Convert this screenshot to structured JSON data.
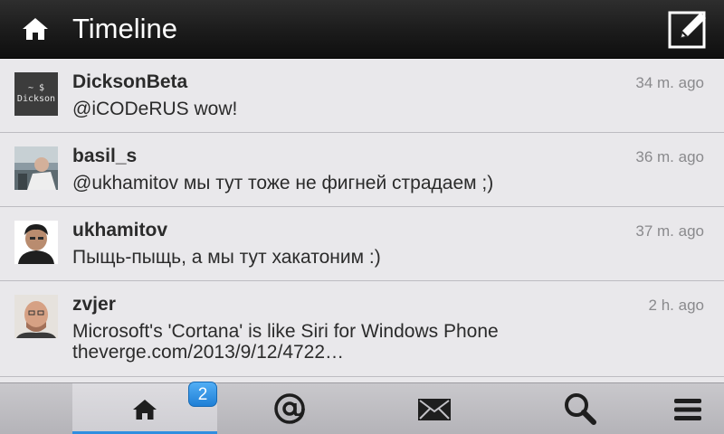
{
  "header": {
    "title": "Timeline",
    "home_icon": "home-icon",
    "compose_icon": "compose-icon"
  },
  "tweets": [
    {
      "author": "DicksonBeta",
      "time": "34 m. ago",
      "text": "@iCODeRUS wow!",
      "avatar_text_1": "~ $",
      "avatar_text_2": "Dickson"
    },
    {
      "author": "basil_s",
      "time": "36 m. ago",
      "text": "@ukhamitov мы тут тоже не фигней страдаем ;)"
    },
    {
      "author": "ukhamitov",
      "time": "37 m. ago",
      "text": "Пыщь-пыщь, а мы тут хакатоним :)"
    },
    {
      "author": "zvjer",
      "time": "2 h. ago",
      "text": "Microsoft's 'Cortana' is like Siri for Windows Phone",
      "link": "theverge.com/2013/9/12/4722…"
    }
  ],
  "tabbar": {
    "tabs": [
      {
        "name": "home",
        "icon": "home-icon",
        "active": true
      },
      {
        "name": "mentions",
        "icon": "at-icon",
        "active": false
      },
      {
        "name": "messages",
        "icon": "envelope-icon",
        "active": false
      },
      {
        "name": "search",
        "icon": "search-icon",
        "active": false
      },
      {
        "name": "menu",
        "icon": "menu-icon",
        "active": false
      }
    ],
    "badge": "2"
  },
  "colors": {
    "header_bg": "#1b1b1b",
    "list_bg": "#e9e8eb",
    "accent": "#2f8ee0",
    "time_text": "#8a8a8d"
  }
}
